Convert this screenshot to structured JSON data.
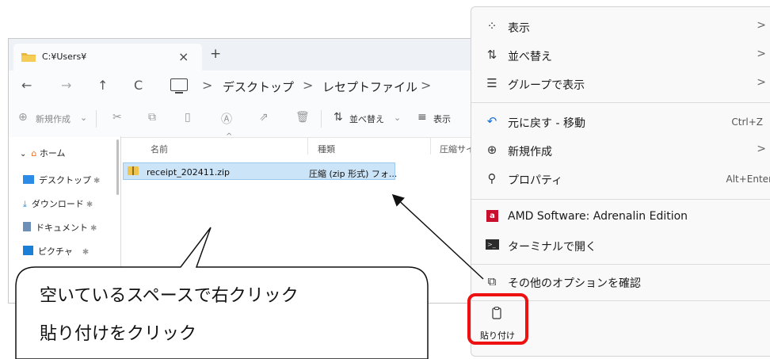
{
  "explorer": {
    "tab_title": "C:¥Users¥",
    "tab_close": "×",
    "new_tab": "+",
    "nav": {
      "back": "←",
      "forward": "→",
      "up": "↑",
      "refresh": "C"
    },
    "breadcrumb": [
      ">",
      "デスクトップ",
      ">",
      "レセプトファイル",
      ">"
    ],
    "toolbar": {
      "new_label": "新規作成",
      "sort_label": "並べ替え",
      "view_label": "表示"
    },
    "sidebar": {
      "home": "ホーム",
      "items": [
        "デスクトップ",
        "ダウンロード",
        "ドキュメント",
        "ピクチャ"
      ]
    },
    "columns": {
      "name": "名前",
      "type": "種類",
      "size": "圧縮サイ"
    },
    "file": {
      "name": "receipt_202411.zip",
      "type": "圧縮 (zip 形式) フォ..."
    }
  },
  "context_menu": {
    "items": [
      {
        "icon": "grid-icon",
        "label": "表示",
        "submenu": ">"
      },
      {
        "icon": "sort-icon",
        "label": "並べ替え",
        "submenu": ">"
      },
      {
        "icon": "group-icon",
        "label": "グループで表示",
        "submenu": ">"
      },
      {
        "icon": "undo-icon",
        "label": "元に戻す - 移動",
        "shortcut": "Ctrl+Z"
      },
      {
        "icon": "plus-circle-icon",
        "label": "新規作成",
        "submenu": ">"
      },
      {
        "icon": "wrench-icon",
        "label": "プロパティ",
        "shortcut": "Alt+Enter"
      },
      {
        "icon": "amd-icon",
        "label": "AMD Software: Adrenalin Edition"
      },
      {
        "icon": "terminal-icon",
        "label": "ターミナルで開く"
      },
      {
        "icon": "more-options-icon",
        "label": "その他のオプションを確認"
      }
    ],
    "paste_label": "貼り付け",
    "amd_glyph": "a",
    "terminal_glyph": ">_"
  },
  "callout": {
    "line1": "空いているスペースで右クリック",
    "line2": "貼り付けをクリック"
  },
  "colors": {
    "highlight": "#ee1111",
    "selection": "#cce4f7",
    "menu_bg": "#f9f9f9"
  }
}
